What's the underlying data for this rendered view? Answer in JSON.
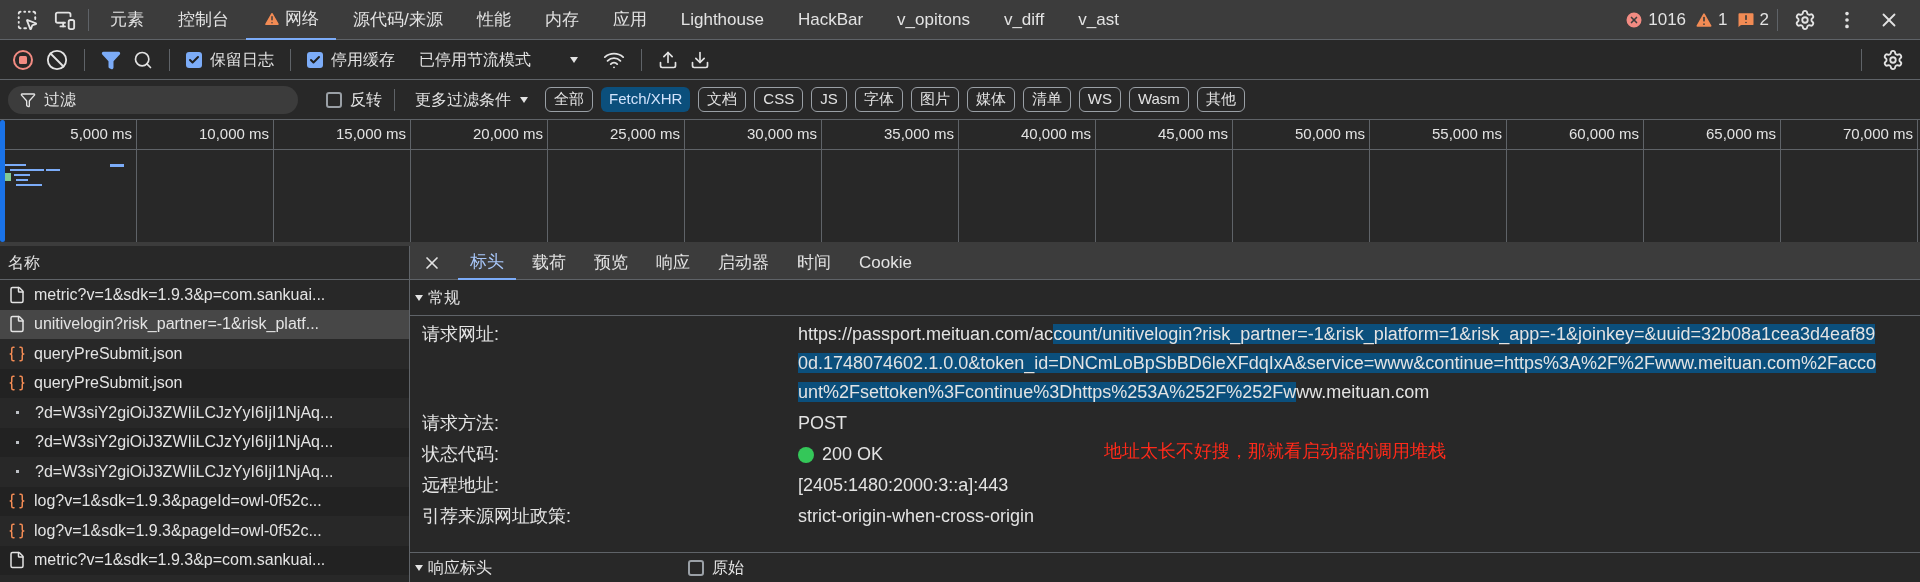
{
  "top_tabs": [
    {
      "label": "元素",
      "selected": false,
      "warning": false
    },
    {
      "label": "控制台",
      "selected": false,
      "warning": false
    },
    {
      "label": "网络",
      "selected": true,
      "warning": true
    },
    {
      "label": "源代码/来源",
      "selected": false,
      "warning": false
    },
    {
      "label": "性能",
      "selected": false,
      "warning": false
    },
    {
      "label": "内存",
      "selected": false,
      "warning": false
    },
    {
      "label": "应用",
      "selected": false,
      "warning": false
    },
    {
      "label": "Lighthouse",
      "selected": false,
      "warning": false
    },
    {
      "label": "HackBar",
      "selected": false,
      "warning": false
    },
    {
      "label": "v_opitons",
      "selected": false,
      "warning": false
    },
    {
      "label": "v_diff",
      "selected": false,
      "warning": false
    },
    {
      "label": "v_ast",
      "selected": false,
      "warning": false
    }
  ],
  "counters": {
    "errors": "1016",
    "warnings": "1",
    "messages": "2"
  },
  "toolbar": {
    "preserve_log": {
      "label": "保留日志",
      "checked": true
    },
    "disable_cache": {
      "label": "停用缓存",
      "checked": true
    },
    "throttling": "已停用节流模式"
  },
  "filter_bar": {
    "placeholder": "过滤",
    "invert": {
      "label": "反转",
      "checked": false
    },
    "more_filters": "更多过滤条件",
    "types": [
      {
        "label": "全部",
        "selected": false
      },
      {
        "label": "Fetch/XHR",
        "selected": true
      },
      {
        "label": "文档",
        "selected": false
      },
      {
        "label": "CSS",
        "selected": false
      },
      {
        "label": "JS",
        "selected": false
      },
      {
        "label": "字体",
        "selected": false
      },
      {
        "label": "图片",
        "selected": false
      },
      {
        "label": "媒体",
        "selected": false
      },
      {
        "label": "清单",
        "selected": false
      },
      {
        "label": "WS",
        "selected": false
      },
      {
        "label": "Wasm",
        "selected": false
      },
      {
        "label": "其他",
        "selected": false
      }
    ]
  },
  "timeline": {
    "ticks": [
      "5,000 ms",
      "10,000 ms",
      "15,000 ms",
      "20,000 ms",
      "25,000 ms",
      "30,000 ms",
      "35,000 ms",
      "40,000 ms",
      "45,000 ms",
      "50,000 ms",
      "55,000 ms",
      "60,000 ms",
      "65,000 ms",
      "70,000 ms"
    ]
  },
  "requests": {
    "header": "名称",
    "rows": [
      {
        "name": "metric?v=1&sdk=1.9.3&p=com.sankuai...",
        "kind": "doc",
        "selected": false
      },
      {
        "name": "unitivelogin?risk_partner=-1&risk_platf...",
        "kind": "doc",
        "selected": true
      },
      {
        "name": "queryPreSubmit.json",
        "kind": "json",
        "selected": false
      },
      {
        "name": "queryPreSubmit.json",
        "kind": "json",
        "selected": false
      },
      {
        "name": "?d=W3siY2giOiJ3ZWIiLCJzYyI6IjI1NjAq...",
        "kind": "ping",
        "selected": false
      },
      {
        "name": "?d=W3siY2giOiJ3ZWIiLCJzYyI6IjI1NjAq...",
        "kind": "ping",
        "selected": false
      },
      {
        "name": "?d=W3siY2giOiJ3ZWIiLCJzYyI6IjI1NjAq...",
        "kind": "ping",
        "selected": false
      },
      {
        "name": "log?v=1&sdk=1.9.3&pageId=owl-0f52c...",
        "kind": "json",
        "selected": false
      },
      {
        "name": "log?v=1&sdk=1.9.3&pageId=owl-0f52c...",
        "kind": "json",
        "selected": false
      },
      {
        "name": "metric?v=1&sdk=1.9.3&p=com.sankuai...",
        "kind": "doc",
        "selected": false
      }
    ]
  },
  "details": {
    "tabs": [
      {
        "label": "标头",
        "selected": true
      },
      {
        "label": "载荷",
        "selected": false
      },
      {
        "label": "预览",
        "selected": false
      },
      {
        "label": "响应",
        "selected": false
      },
      {
        "label": "启动器",
        "selected": false
      },
      {
        "label": "时间",
        "selected": false
      },
      {
        "label": "Cookie",
        "selected": false
      }
    ],
    "general": {
      "title": "常规",
      "expanded": true,
      "rows": [
        {
          "kind": "url",
          "label": "请求网址:",
          "before": "https://passport.meituan.com/ac",
          "highlighted": "count/unitivelogin?risk_partner=-1&risk_platform=1&risk_app=-1&joinkey=&uuid=32b08a1cea3d4eaf890d.1748074602.1.0.0&token_id=DNCmLoBpSbBD6leXFdqIxA&service=www&continue=https%3A%2F%2Fwww.meituan.com%2Faccount%2Fsettoken%3Fcontinue%3Dhttps%253A%252F%252Fw",
          "after": "ww.meituan.com"
        },
        {
          "kind": "text",
          "label": "请求方法:",
          "value": "POST"
        },
        {
          "kind": "status",
          "label": "状态代码:",
          "value": "200 OK",
          "color": "#34c759"
        },
        {
          "kind": "text",
          "label": "远程地址:",
          "value": "[2405:1480:2000:3::a]:443"
        },
        {
          "kind": "text",
          "label": "引荐来源网址政策:",
          "value": "strict-origin-when-cross-origin"
        }
      ]
    },
    "annotation": "地址太长不好搜，那就看启动器的调用堆栈",
    "response_headers": {
      "title": "响应标头",
      "expanded": true,
      "raw": {
        "label": "原始",
        "checked": false
      }
    }
  }
}
